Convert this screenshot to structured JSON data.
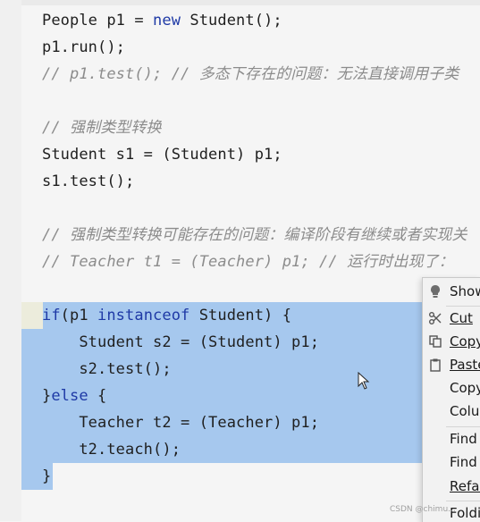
{
  "editor": {
    "lines": [
      "People p1 = new Student();",
      "p1.run();",
      "// p1.test(); // 多态下存在的问题：无法直接调用子类",
      "// 强制类型转换",
      "Student s1 = (Student) p1;",
      "s1.test();",
      "// 强制类型转换可能存在的问题：编译阶段有继续或者实现关",
      "// Teacher t1 = (Teacher) p1; // 运行时出现了：",
      "if(p1 instanceof Student) {",
      "    Student s2 = (Student) p1;",
      "    s2.test();",
      "}else {",
      "    Teacher t2 = (Teacher) p1;",
      "    t2.teach();",
      "}"
    ]
  },
  "context_menu": {
    "items": [
      {
        "label": "Show",
        "icon": "lightbulb-icon"
      },
      {
        "label": "Cut",
        "icon": "scissors-icon"
      },
      {
        "label": "Copy",
        "icon": "copy-icon"
      },
      {
        "label": "Paste",
        "icon": "clipboard-icon"
      },
      {
        "label": "Copy",
        "icon": ""
      },
      {
        "label": "Colu",
        "icon": ""
      },
      {
        "label": "Find",
        "icon": ""
      },
      {
        "label": "Find",
        "icon": ""
      },
      {
        "label": "Refac",
        "icon": ""
      },
      {
        "label": "Foldi",
        "icon": ""
      }
    ]
  },
  "watermark": "CSDN @chimu..."
}
